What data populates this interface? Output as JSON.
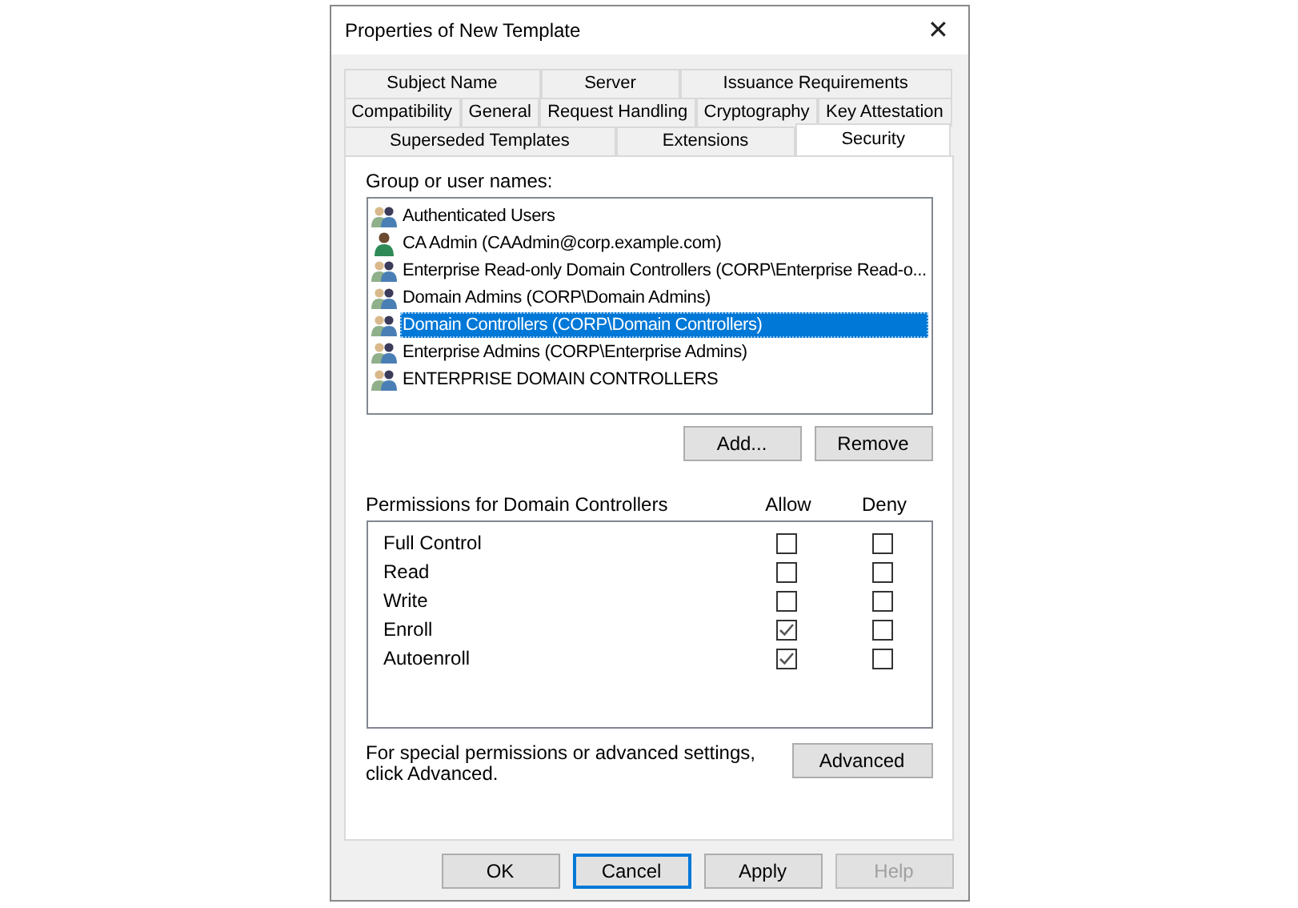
{
  "window": {
    "title": "Properties of New Template",
    "close": "✕"
  },
  "tab_rows": [
    [
      {
        "label": "Subject Name",
        "selected": false
      },
      {
        "label": "Server",
        "selected": false
      },
      {
        "label": "Issuance Requirements",
        "selected": false
      }
    ],
    [
      {
        "label": "Compatibility",
        "selected": false
      },
      {
        "label": "General",
        "selected": false
      },
      {
        "label": "Request Handling",
        "selected": false
      },
      {
        "label": "Cryptography",
        "selected": false
      },
      {
        "label": "Key Attestation",
        "selected": false
      }
    ],
    [
      {
        "label": "Superseded Templates",
        "selected": false
      },
      {
        "label": "Extensions",
        "selected": false
      },
      {
        "label": "Security",
        "selected": true
      }
    ]
  ],
  "groups": {
    "label": "Group or user names:",
    "items": [
      {
        "name": "Authenticated Users",
        "kind": "group",
        "selected": false
      },
      {
        "name": "CA Admin (CAAdmin@corp.example.com)",
        "kind": "user",
        "selected": false
      },
      {
        "name": "Enterprise Read-only Domain Controllers (CORP\\Enterprise Read-o...",
        "kind": "group",
        "selected": false
      },
      {
        "name": "Domain Admins (CORP\\Domain Admins)",
        "kind": "group",
        "selected": false
      },
      {
        "name": "Domain Controllers (CORP\\Domain Controllers)",
        "kind": "group",
        "selected": true
      },
      {
        "name": "Enterprise Admins (CORP\\Enterprise Admins)",
        "kind": "group",
        "selected": false
      },
      {
        "name": "ENTERPRISE DOMAIN CONTROLLERS",
        "kind": "group",
        "selected": false
      }
    ],
    "buttons": [
      "Add...",
      "Remove"
    ]
  },
  "permissions": {
    "label": "Permissions for Domain Controllers",
    "allow_header": "Allow",
    "deny_header": "Deny",
    "rows": [
      {
        "name": "Full Control",
        "allow": false,
        "deny": false
      },
      {
        "name": "Read",
        "allow": false,
        "deny": false
      },
      {
        "name": "Write",
        "allow": false,
        "deny": false
      },
      {
        "name": "Enroll",
        "allow": true,
        "deny": false
      },
      {
        "name": "Autoenroll",
        "allow": true,
        "deny": false
      }
    ]
  },
  "advanced": {
    "text": "For special permissions or advanced settings, click Advanced.",
    "button": "Advanced"
  },
  "buttons": [
    {
      "label": "OK",
      "default": false,
      "disabled": false
    },
    {
      "label": "Cancel",
      "default": true,
      "disabled": false
    },
    {
      "label": "Apply",
      "default": false,
      "disabled": false
    },
    {
      "label": "Help",
      "default": false,
      "disabled": true
    }
  ]
}
